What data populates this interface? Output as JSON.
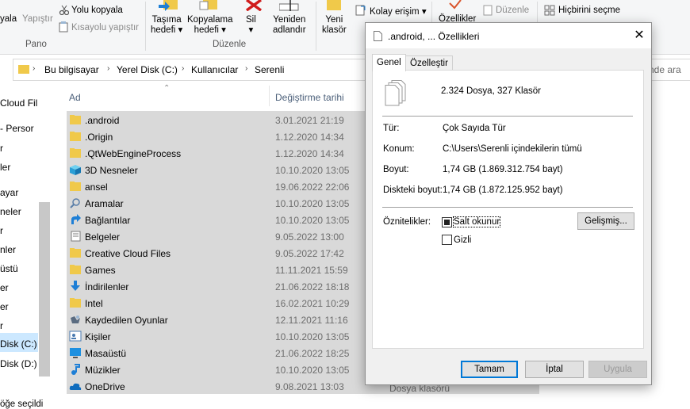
{
  "ribbon": {
    "paste_label_partial": "yala",
    "paste_shortcut_partial": "Yapıştır",
    "copy_path": "Yolu kopyala",
    "paste_shortcut": "Kısayolu yapıştır",
    "section_clipboard": "Pano",
    "move_to": [
      "Taşıma",
      "hedefi"
    ],
    "copy_to": [
      "Kopyalama",
      "hedefi"
    ],
    "delete": "Sil",
    "rename": [
      "Yeniden",
      "adlandır"
    ],
    "section_organize": "Düzenle",
    "new_folder": [
      "Yeni",
      "klasör"
    ],
    "easy_access": "Kolay erişim",
    "properties_partial": "Özellikler",
    "edit": "Düzenle",
    "select_none": "Hiçbirini seçme"
  },
  "address": {
    "crumbs": [
      "Bu bilgisayar",
      "Yerel Disk (C:)",
      "Kullanıcılar",
      "Serenli"
    ],
    "search_tail": "nde ara"
  },
  "nav": {
    "items": [
      "Cloud Fil",
      "- Persor",
      "r",
      "ler",
      "ayar",
      "neler",
      "r",
      "nler",
      "üstü",
      "er",
      "er",
      "r",
      "Disk (C:)",
      "Disk (D:)"
    ]
  },
  "list": {
    "col_name": "Ad",
    "col_date": "Değiştirme tarihi",
    "rows": [
      {
        "name": ".android",
        "date": "3.01.2021 21:19",
        "icon": "folder-icon"
      },
      {
        "name": ".Origin",
        "date": "1.12.2020 14:34",
        "icon": "folder-icon"
      },
      {
        "name": ".QtWebEngineProcess",
        "date": "1.12.2020 14:34",
        "icon": "folder-icon"
      },
      {
        "name": "3D Nesneler",
        "date": "10.10.2020 13:05",
        "icon": "cube-3d-icon"
      },
      {
        "name": "ansel",
        "date": "19.06.2022 22:06",
        "icon": "folder-icon"
      },
      {
        "name": "Aramalar",
        "date": "10.10.2020 13:05",
        "icon": "search-icon"
      },
      {
        "name": "Bağlantılar",
        "date": "10.10.2020 13:05",
        "icon": "link-arrow-icon"
      },
      {
        "name": "Belgeler",
        "date": "9.05.2022 13:00",
        "icon": "documents-icon"
      },
      {
        "name": "Creative Cloud Files",
        "date": "9.05.2022 17:42",
        "icon": "folder-icon"
      },
      {
        "name": "Games",
        "date": "11.11.2021 15:59",
        "icon": "folder-icon"
      },
      {
        "name": "İndirilenler",
        "date": "21.06.2022 18:18",
        "icon": "download-icon"
      },
      {
        "name": "Intel",
        "date": "16.02.2021 10:29",
        "icon": "folder-icon"
      },
      {
        "name": "Kaydedilen Oyunlar",
        "date": "12.11.2021 11:16",
        "icon": "gamepad-icon"
      },
      {
        "name": "Kişiler",
        "date": "10.10.2020 13:05",
        "icon": "contacts-icon"
      },
      {
        "name": "Masaüstü",
        "date": "21.06.2022 18:25",
        "icon": "desktop-icon"
      },
      {
        "name": "Müzikler",
        "date": "10.10.2020 13:05",
        "icon": "music-icon"
      },
      {
        "name": "OneDrive",
        "date": "9.08.2021 13:03",
        "icon": "cloud-icon"
      }
    ],
    "last_row_type": "Dosya klasörü"
  },
  "status": {
    "text_partial": "öğe seçildi"
  },
  "dialog": {
    "title": ".android, ... Özellikleri",
    "tab_general": "Genel",
    "tab_custom": "Özelleştir",
    "summary": "2.324 Dosya, 327 Klasör",
    "type_label": "Tür:",
    "type_value": "Çok Sayıda Tür",
    "location_label": "Konum:",
    "location_value": "C:\\Users\\Serenli içindekilerin tümü",
    "size_label": "Boyut:",
    "size_value": "1,74 GB (1.869.312.754 bayt)",
    "disk_size_label": "Diskteki boyut:",
    "disk_size_value": "1,74 GB (1.872.125.952 bayt)",
    "attributes_label": "Öznitelikler:",
    "readonly_label": "Salt okunur",
    "hidden_label": "Gizli",
    "advanced_button": "Gelişmiş...",
    "ok_button": "Tamam",
    "cancel_button": "İptal",
    "apply_button": "Uygula"
  },
  "colors": {
    "selection": "#d9d9d9",
    "folder": "#f0c94a",
    "accent": "#0078d7"
  }
}
